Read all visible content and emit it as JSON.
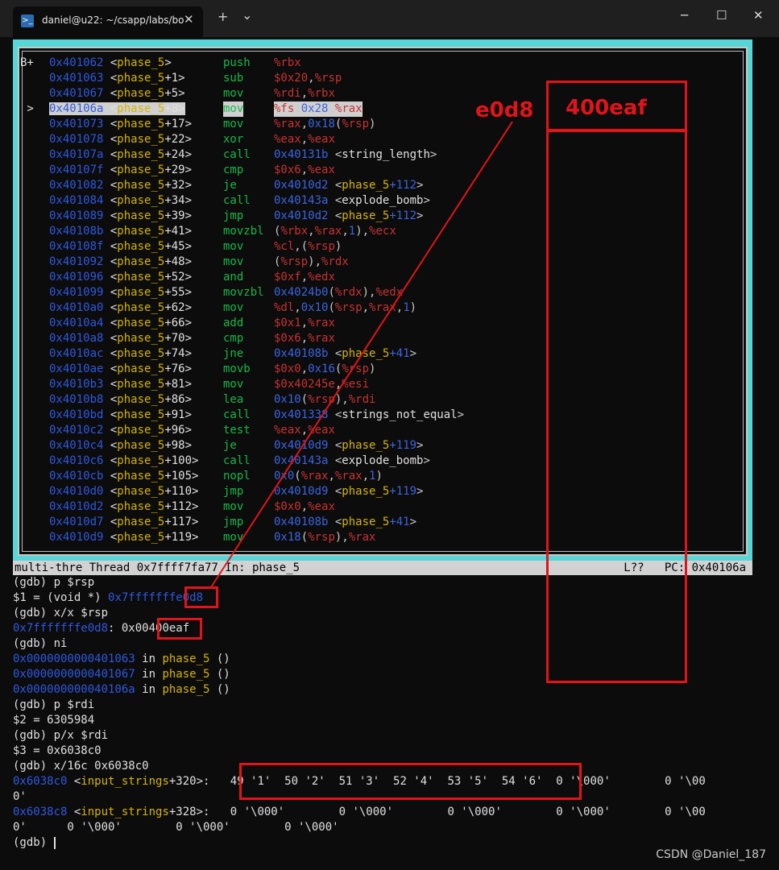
{
  "window": {
    "tab_title": "daniel@u22: ~/csapp/labs/bo",
    "tab_icon": "terminal-icon",
    "new_tab": "+",
    "dropdown": "⌄",
    "close_tab": "✕",
    "minimize": "─",
    "maximize": "☐",
    "close": "✕"
  },
  "asm": {
    "lines": [
      {
        "mark": "B+ ",
        "addr": "0x401062",
        "fn": "phase_5",
        "off": "",
        "mn": "push",
        "ops": [
          [
            "reg",
            "%rbx"
          ]
        ]
      },
      {
        "mark": "   ",
        "addr": "0x401063",
        "fn": "phase_5",
        "off": "+1",
        "mn": "sub",
        "ops": [
          [
            "imm",
            "$0x20"
          ],
          [
            "op",
            ","
          ],
          [
            "reg",
            "%rsp"
          ]
        ]
      },
      {
        "mark": "   ",
        "addr": "0x401067",
        "fn": "phase_5",
        "off": "+5",
        "mn": "mov",
        "ops": [
          [
            "reg",
            "%rdi"
          ],
          [
            "op",
            ","
          ],
          [
            "reg",
            "%rbx"
          ]
        ]
      },
      {
        "mark": " > ",
        "addr": "0x40106a",
        "fn": "phase_5",
        "off": "+8",
        "mn": "mov",
        "ops": [
          [
            "reg",
            "%fs"
          ],
          [
            "op",
            ":"
          ],
          [
            "num",
            "0x28"
          ],
          [
            "op",
            ","
          ],
          [
            "reg",
            "%rax"
          ]
        ],
        "current": true
      },
      {
        "mark": "   ",
        "addr": "0x401073",
        "fn": "phase_5",
        "off": "+17",
        "mn": "mov",
        "ops": [
          [
            "reg",
            "%rax"
          ],
          [
            "op",
            ","
          ],
          [
            "num",
            "0x18"
          ],
          [
            "op",
            "("
          ],
          [
            "reg",
            "%rsp"
          ],
          [
            "op",
            ")"
          ]
        ]
      },
      {
        "mark": "   ",
        "addr": "0x401078",
        "fn": "phase_5",
        "off": "+22",
        "mn": "xor",
        "ops": [
          [
            "reg",
            "%eax"
          ],
          [
            "op",
            ","
          ],
          [
            "reg",
            "%eax"
          ]
        ]
      },
      {
        "mark": "   ",
        "addr": "0x40107a",
        "fn": "phase_5",
        "off": "+24",
        "mn": "call",
        "ops": [
          [
            "num",
            "0x40131b"
          ],
          [
            "op",
            " <"
          ],
          [
            "sym",
            "string_length"
          ],
          [
            "op",
            ">"
          ]
        ]
      },
      {
        "mark": "   ",
        "addr": "0x40107f",
        "fn": "phase_5",
        "off": "+29",
        "mn": "cmp",
        "ops": [
          [
            "imm",
            "$0x6"
          ],
          [
            "op",
            ","
          ],
          [
            "reg",
            "%eax"
          ]
        ]
      },
      {
        "mark": "   ",
        "addr": "0x401082",
        "fn": "phase_5",
        "off": "+32",
        "mn": "je",
        "ops": [
          [
            "num",
            "0x4010d2"
          ],
          [
            "op",
            " <"
          ],
          [
            "fnref",
            "phase_5"
          ],
          [
            "num",
            "+112"
          ],
          [
            "op",
            ">"
          ]
        ]
      },
      {
        "mark": "   ",
        "addr": "0x401084",
        "fn": "phase_5",
        "off": "+34",
        "mn": "call",
        "ops": [
          [
            "num",
            "0x40143a"
          ],
          [
            "op",
            " <"
          ],
          [
            "sym",
            "explode_bomb"
          ],
          [
            "op",
            ">"
          ]
        ]
      },
      {
        "mark": "   ",
        "addr": "0x401089",
        "fn": "phase_5",
        "off": "+39",
        "mn": "jmp",
        "ops": [
          [
            "num",
            "0x4010d2"
          ],
          [
            "op",
            " <"
          ],
          [
            "fnref",
            "phase_5"
          ],
          [
            "num",
            "+112"
          ],
          [
            "op",
            ">"
          ]
        ]
      },
      {
        "mark": "   ",
        "addr": "0x40108b",
        "fn": "phase_5",
        "off": "+41",
        "mn": "movzbl",
        "ops": [
          [
            "op",
            "("
          ],
          [
            "reg",
            "%rbx"
          ],
          [
            "op",
            ","
          ],
          [
            "reg",
            "%rax"
          ],
          [
            "op",
            ","
          ],
          [
            "num",
            "1"
          ],
          [
            "op",
            "),"
          ],
          [
            "reg",
            "%ecx"
          ]
        ]
      },
      {
        "mark": "   ",
        "addr": "0x40108f",
        "fn": "phase_5",
        "off": "+45",
        "mn": "mov",
        "ops": [
          [
            "reg",
            "%cl"
          ],
          [
            "op",
            ",("
          ],
          [
            "reg",
            "%rsp"
          ],
          [
            "op",
            ")"
          ]
        ]
      },
      {
        "mark": "   ",
        "addr": "0x401092",
        "fn": "phase_5",
        "off": "+48",
        "mn": "mov",
        "ops": [
          [
            "op",
            "("
          ],
          [
            "reg",
            "%rsp"
          ],
          [
            "op",
            "),"
          ],
          [
            "reg",
            "%rdx"
          ]
        ]
      },
      {
        "mark": "   ",
        "addr": "0x401096",
        "fn": "phase_5",
        "off": "+52",
        "mn": "and",
        "ops": [
          [
            "imm",
            "$0xf"
          ],
          [
            "op",
            ","
          ],
          [
            "reg",
            "%edx"
          ]
        ]
      },
      {
        "mark": "   ",
        "addr": "0x401099",
        "fn": "phase_5",
        "off": "+55",
        "mn": "movzbl",
        "ops": [
          [
            "num",
            "0x4024b0"
          ],
          [
            "op",
            "("
          ],
          [
            "reg",
            "%rdx"
          ],
          [
            "op",
            "),"
          ],
          [
            "reg",
            "%edx"
          ]
        ]
      },
      {
        "mark": "   ",
        "addr": "0x4010a0",
        "fn": "phase_5",
        "off": "+62",
        "mn": "mov",
        "ops": [
          [
            "reg",
            "%dl"
          ],
          [
            "op",
            ","
          ],
          [
            "num",
            "0x10"
          ],
          [
            "op",
            "("
          ],
          [
            "reg",
            "%rsp"
          ],
          [
            "op",
            ","
          ],
          [
            "reg",
            "%rax"
          ],
          [
            "op",
            ","
          ],
          [
            "num",
            "1"
          ],
          [
            "op",
            ")"
          ]
        ]
      },
      {
        "mark": "   ",
        "addr": "0x4010a4",
        "fn": "phase_5",
        "off": "+66",
        "mn": "add",
        "ops": [
          [
            "imm",
            "$0x1"
          ],
          [
            "op",
            ","
          ],
          [
            "reg",
            "%rax"
          ]
        ]
      },
      {
        "mark": "   ",
        "addr": "0x4010a8",
        "fn": "phase_5",
        "off": "+70",
        "mn": "cmp",
        "ops": [
          [
            "imm",
            "$0x6"
          ],
          [
            "op",
            ","
          ],
          [
            "reg",
            "%rax"
          ]
        ]
      },
      {
        "mark": "   ",
        "addr": "0x4010ac",
        "fn": "phase_5",
        "off": "+74",
        "mn": "jne",
        "ops": [
          [
            "num",
            "0x40108b"
          ],
          [
            "op",
            " <"
          ],
          [
            "fnref",
            "phase_5"
          ],
          [
            "num",
            "+41"
          ],
          [
            "op",
            ">"
          ]
        ]
      },
      {
        "mark": "   ",
        "addr": "0x4010ae",
        "fn": "phase_5",
        "off": "+76",
        "mn": "movb",
        "ops": [
          [
            "imm",
            "$0x0"
          ],
          [
            "op",
            ","
          ],
          [
            "num",
            "0x16"
          ],
          [
            "op",
            "("
          ],
          [
            "reg",
            "%rsp"
          ],
          [
            "op",
            ")"
          ]
        ]
      },
      {
        "mark": "   ",
        "addr": "0x4010b3",
        "fn": "phase_5",
        "off": "+81",
        "mn": "mov",
        "ops": [
          [
            "imm",
            "$0x40245e"
          ],
          [
            "op",
            ","
          ],
          [
            "reg",
            "%esi"
          ]
        ]
      },
      {
        "mark": "   ",
        "addr": "0x4010b8",
        "fn": "phase_5",
        "off": "+86",
        "mn": "lea",
        "ops": [
          [
            "num",
            "0x10"
          ],
          [
            "op",
            "("
          ],
          [
            "reg",
            "%rsp"
          ],
          [
            "op",
            "),"
          ],
          [
            "reg",
            "%rdi"
          ]
        ]
      },
      {
        "mark": "   ",
        "addr": "0x4010bd",
        "fn": "phase_5",
        "off": "+91",
        "mn": "call",
        "ops": [
          [
            "num",
            "0x401338"
          ],
          [
            "op",
            " <"
          ],
          [
            "sym",
            "strings_not_equal"
          ],
          [
            "op",
            ">"
          ]
        ]
      },
      {
        "mark": "   ",
        "addr": "0x4010c2",
        "fn": "phase_5",
        "off": "+96",
        "mn": "test",
        "ops": [
          [
            "reg",
            "%eax"
          ],
          [
            "op",
            ","
          ],
          [
            "reg",
            "%eax"
          ]
        ]
      },
      {
        "mark": "   ",
        "addr": "0x4010c4",
        "fn": "phase_5",
        "off": "+98",
        "mn": "je",
        "ops": [
          [
            "num",
            "0x4010d9"
          ],
          [
            "op",
            " <"
          ],
          [
            "fnref",
            "phase_5"
          ],
          [
            "num",
            "+119"
          ],
          [
            "op",
            ">"
          ]
        ]
      },
      {
        "mark": "   ",
        "addr": "0x4010c6",
        "fn": "phase_5",
        "off": "+100",
        "mn": "call",
        "ops": [
          [
            "num",
            "0x40143a"
          ],
          [
            "op",
            " <"
          ],
          [
            "sym",
            "explode_bomb"
          ],
          [
            "op",
            ">"
          ]
        ]
      },
      {
        "mark": "   ",
        "addr": "0x4010cb",
        "fn": "phase_5",
        "off": "+105",
        "mn": "nopl",
        "ops": [
          [
            "num",
            "0x0"
          ],
          [
            "op",
            "("
          ],
          [
            "reg",
            "%rax"
          ],
          [
            "op",
            ","
          ],
          [
            "reg",
            "%rax"
          ],
          [
            "op",
            ","
          ],
          [
            "num",
            "1"
          ],
          [
            "op",
            ")"
          ]
        ]
      },
      {
        "mark": "   ",
        "addr": "0x4010d0",
        "fn": "phase_5",
        "off": "+110",
        "mn": "jmp",
        "ops": [
          [
            "num",
            "0x4010d9"
          ],
          [
            "op",
            " <"
          ],
          [
            "fnref",
            "phase_5"
          ],
          [
            "num",
            "+119"
          ],
          [
            "op",
            ">"
          ]
        ]
      },
      {
        "mark": "   ",
        "addr": "0x4010d2",
        "fn": "phase_5",
        "off": "+112",
        "mn": "mov",
        "ops": [
          [
            "imm",
            "$0x0"
          ],
          [
            "op",
            ","
          ],
          [
            "reg",
            "%eax"
          ]
        ]
      },
      {
        "mark": "   ",
        "addr": "0x4010d7",
        "fn": "phase_5",
        "off": "+117",
        "mn": "jmp",
        "ops": [
          [
            "num",
            "0x40108b"
          ],
          [
            "op",
            " <"
          ],
          [
            "fnref",
            "phase_5"
          ],
          [
            "num",
            "+41"
          ],
          [
            "op",
            ">"
          ]
        ]
      },
      {
        "mark": "   ",
        "addr": "0x4010d9",
        "fn": "phase_5",
        "off": "+119",
        "mn": "mov",
        "ops": [
          [
            "num",
            "0x18"
          ],
          [
            "op",
            "("
          ],
          [
            "reg",
            "%rsp"
          ],
          [
            "op",
            "),"
          ],
          [
            "reg",
            "%rax"
          ]
        ]
      }
    ]
  },
  "status": {
    "left": "multi-thre Thread 0x7ffff7fa77 In: phase_5",
    "right": "L??   PC: 0x40106a"
  },
  "terminal": {
    "lines": [
      [
        [
          "txt",
          "(gdb) p $rsp"
        ]
      ],
      [
        [
          "txt",
          "$1 = (void *) "
        ],
        [
          "addr",
          "0x7fffffffe0d8"
        ]
      ],
      [
        [
          "txt",
          "(gdb) x/x $rsp"
        ]
      ],
      [
        [
          "addr",
          "0x7fffffffe0d8"
        ],
        [
          "txt",
          ": 0x00400eaf"
        ]
      ],
      [
        [
          "txt",
          "(gdb) ni"
        ]
      ],
      [
        [
          "addr",
          "0x0000000000401063"
        ],
        [
          "txt",
          " in "
        ],
        [
          "fn",
          "phase_5"
        ],
        [
          "txt",
          " ()"
        ]
      ],
      [
        [
          "addr",
          "0x0000000000401067"
        ],
        [
          "txt",
          " in "
        ],
        [
          "fn",
          "phase_5"
        ],
        [
          "txt",
          " ()"
        ]
      ],
      [
        [
          "addr",
          "0x000000000040106a"
        ],
        [
          "txt",
          " in "
        ],
        [
          "fn",
          "phase_5"
        ],
        [
          "txt",
          " ()"
        ]
      ],
      [
        [
          "txt",
          "(gdb) p $rdi"
        ]
      ],
      [
        [
          "txt",
          "$2 = 6305984"
        ]
      ],
      [
        [
          "txt",
          "(gdb) p/x $rdi"
        ]
      ],
      [
        [
          "txt",
          "$3 = 0x6038c0"
        ]
      ],
      [
        [
          "txt",
          "(gdb) x/16c 0x6038c0"
        ]
      ],
      [
        [
          "addr",
          "0x6038c0"
        ],
        [
          "txt",
          " <"
        ],
        [
          "fn",
          "input_strings"
        ],
        [
          "txt",
          "+320>:   49 '1'  50 '2'  51 '3'  52 '4'  53 '5'  54 '6'  0 '\\000'        0 '\\00"
        ]
      ],
      [
        [
          "txt",
          "0'"
        ]
      ],
      [
        [
          "addr",
          "0x6038c8"
        ],
        [
          "txt",
          " <"
        ],
        [
          "fn",
          "input_strings"
        ],
        [
          "txt",
          "+328>:   0 '\\000'        0 '\\000'        0 '\\000'        0 '\\000'        0 '\\00"
        ]
      ],
      [
        [
          "txt",
          "0'      0 '\\000'        0 '\\000'        0 '\\000'"
        ]
      ],
      [
        [
          "txt",
          "(gdb) "
        ],
        [
          "cursor",
          ""
        ]
      ]
    ]
  },
  "annotations": {
    "label_e0d8": "e0d8",
    "label_400eaf": "400eaf",
    "color": "#e0141a"
  },
  "watermark": "CSDN @Daniel_187"
}
